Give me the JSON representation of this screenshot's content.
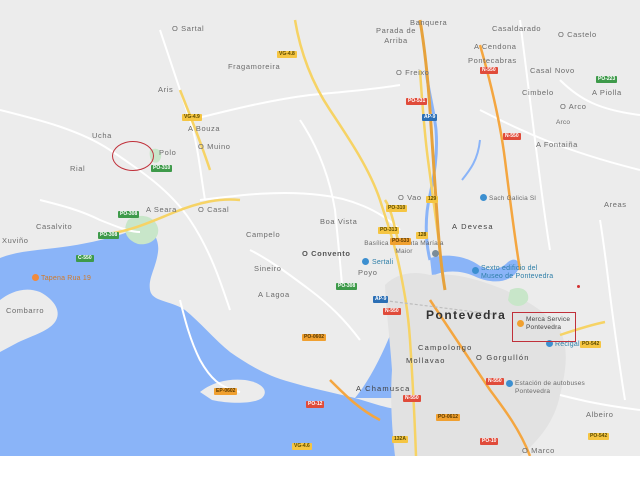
{
  "map": {
    "towns": [
      "O Sartal",
      "Parada de Arriba",
      "Banquera",
      "Casaldarado",
      "O Castelo",
      "Fragamoreira",
      "A Cendona",
      "Pontecabras",
      "Casal Novo",
      "Aris",
      "O Freixo",
      "Cimbelo",
      "O Arco",
      "A Piolla",
      "A Bouza",
      "Ucha",
      "Polo",
      "O Muino",
      "A Fontaiña",
      "Rial",
      "O Vao",
      "A Seara",
      "O Casal",
      "Boa Vista",
      "A Devesa",
      "Areas",
      "Xuviño",
      "Casalvito",
      "Campelo",
      "O Convento",
      "Poyo",
      "Sineiro",
      "A Lagoa",
      "Combarro",
      "Pontevedra",
      "Campolongo",
      "O Gorgullón",
      "Mollavao",
      "A Chamusca",
      "Albeiro",
      "O Marco",
      "Arco"
    ],
    "pois": {
      "tapena": "Tapena Rua 19",
      "sertali": "Sertali",
      "basilica": "Basílica de Santa María a Maior",
      "museo": "Sexto edificio del Museo de Pontevedra",
      "sach": "Sach Galicia Sl",
      "merca": "Merca Service Pontevedra",
      "recigal": "Recigal",
      "estacion": "Estación de autobuses Pontevedra"
    },
    "roads": {
      "vg48": "VG-4.8",
      "vg48b": "VG-4.8",
      "po531": "PO-531",
      "n550a": "N-550",
      "ap9a": "AP-9",
      "n550b": "N-550",
      "po223": "PO-223",
      "vg49": "VG-4.9",
      "po310a": "PO-310",
      "po308a": "PO-308",
      "po308b": "PO-308",
      "c550": "C-550",
      "po310b": "PO-310",
      "po313": "PO-313",
      "po533": "PO-533",
      "po308c": "PO-308",
      "ap9b": "AP-9",
      "n550c": "N-550",
      "po542": "PO-542",
      "po0602": "PO-0602",
      "ep0602": "EP-0602",
      "po12": "PO-12",
      "n550d": "N-550",
      "po0612": "PO-0612",
      "po10": "PO-10",
      "vg46": "VG-4.6",
      "po542b": "PO-542",
      "r129": "129",
      "r128": "128",
      "r132a": "132A",
      "n550e": "N-550"
    },
    "annotations": {
      "callout": "Merca Service Pontevedra highlight",
      "circle": "highlighted area near Polo"
    }
  }
}
